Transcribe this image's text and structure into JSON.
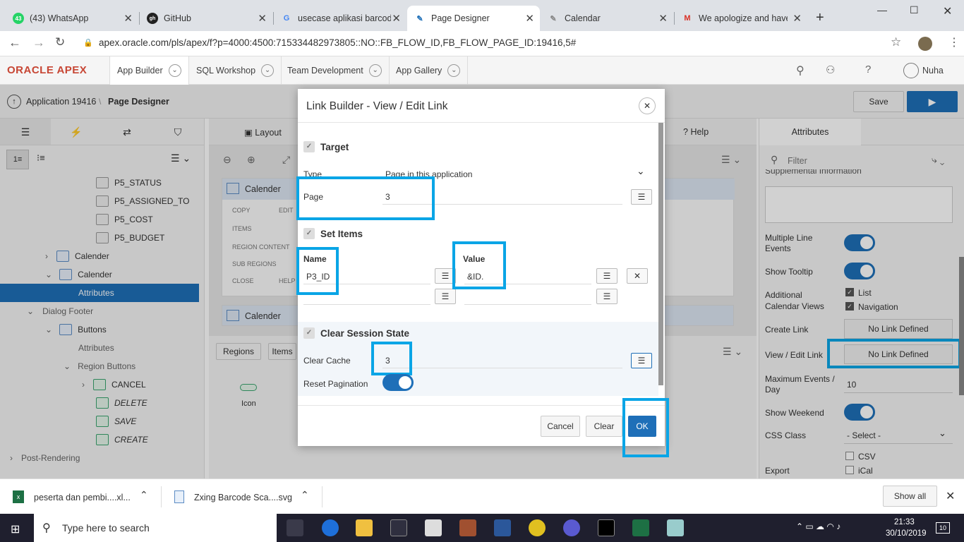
{
  "browser": {
    "tabs": [
      {
        "label": "(43) WhatsApp",
        "icon": "43"
      },
      {
        "label": "GitHub",
        "icon": "gh"
      },
      {
        "label": "usecase aplikasi barcod",
        "icon": "G"
      },
      {
        "label": "Page Designer",
        "icon": "pd"
      },
      {
        "label": "Calendar",
        "icon": "cal"
      },
      {
        "label": "We apologize and have",
        "icon": "M"
      }
    ],
    "url": "apex.oracle.com/pls/apex/f?p=4000:4500:715334482973805::NO::FB_FLOW_ID,FB_FLOW_PAGE_ID:19416,5#"
  },
  "apex": {
    "logo": "ORACLE APEX",
    "nav": [
      "App Builder",
      "SQL Workshop",
      "Team Development",
      "App Gallery"
    ],
    "user": "Nuha",
    "breadcrumb_app": "Application 19416",
    "breadcrumb_page": "Page Designer",
    "save_label": "Save"
  },
  "left_tree": {
    "items": [
      {
        "label": "P5_STATUS"
      },
      {
        "label": "P5_ASSIGNED_TO"
      },
      {
        "label": "P5_COST"
      },
      {
        "label": "P5_BUDGET"
      },
      {
        "label": "Calender"
      },
      {
        "label": "Calender"
      },
      {
        "label": "Attributes"
      },
      {
        "label": "Dialog Footer"
      },
      {
        "label": "Buttons"
      },
      {
        "label": "Attributes"
      },
      {
        "label": "Region Buttons"
      },
      {
        "label": "CANCEL"
      },
      {
        "label": "DELETE"
      },
      {
        "label": "SAVE"
      },
      {
        "label": "CREATE"
      },
      {
        "label": "Post-Rendering"
      }
    ]
  },
  "middle": {
    "layout_label": "Layout",
    "help_label": "Help",
    "region_title": "Calender",
    "region_labels": [
      "COPY",
      "EDIT",
      "ITEMS",
      "REGION CONTENT",
      "SUB REGIONS",
      "CLOSE",
      "HELP"
    ],
    "region2_title": "Calender",
    "tabs": [
      "Regions",
      "Items"
    ],
    "icon_label": "Icon"
  },
  "right": {
    "tab": "Attributes",
    "filter_placeholder": "Filter",
    "supplemental": "Supplemental Information",
    "multiline": "Multiple Line Events",
    "tooltip": "Show Tooltip",
    "additional": "Additional Calendar Views",
    "list": "List",
    "navigation": "Navigation",
    "create_link": "Create Link",
    "create_link_value": "No Link Defined",
    "view_edit_link": "View / Edit Link",
    "view_edit_value": "No Link Defined",
    "max_events": "Maximum Events / Day",
    "max_events_value": "10",
    "show_weekend": "Show Weekend",
    "css_class": "CSS Class",
    "css_class_value": "- Select -",
    "export": "Export",
    "csv": "CSV",
    "ical": "iCal"
  },
  "dialog": {
    "title": "Link Builder - View / Edit Link",
    "target_section": "Target",
    "type_label": "Type",
    "type_value": "Page in this application",
    "page_label": "Page",
    "page_value": "3",
    "set_items_section": "Set Items",
    "name_header": "Name",
    "value_header": "Value",
    "item_name": "P3_ID",
    "item_value": "&ID.",
    "clear_section": "Clear Session State",
    "clear_cache_label": "Clear Cache",
    "clear_cache_value": "3",
    "reset_pagination_label": "Reset Pagination",
    "cancel": "Cancel",
    "clear": "Clear",
    "ok": "OK"
  },
  "downloads": {
    "file1": "peserta dan pembi....xl...",
    "file2": "Zxing Barcode Sca....svg",
    "show_all": "Show all"
  },
  "taskbar": {
    "search": "Type here to search",
    "time": "21:33",
    "date": "30/10/2019",
    "notif": "10"
  },
  "colors": {
    "accent": "#0aa5e6",
    "apex_blue": "#1e6fb8",
    "oracle_red": "#c74634"
  }
}
